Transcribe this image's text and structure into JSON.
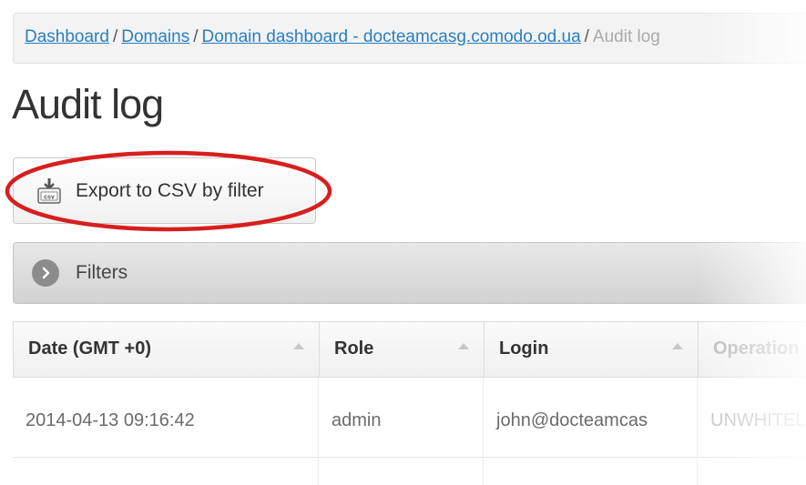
{
  "breadcrumb": {
    "items": [
      {
        "label": "Dashboard"
      },
      {
        "label": "Domains"
      },
      {
        "label": "Domain dashboard - docteamcasg.comodo.od.ua"
      }
    ],
    "separator": "/",
    "current": "Audit log"
  },
  "page": {
    "title": "Audit log"
  },
  "toolbar": {
    "export_label": "Export to CSV by filter",
    "export_icon": "csv-download-icon",
    "icon_text": "csv"
  },
  "filters": {
    "label": "Filters",
    "icon": "chevron-right-icon"
  },
  "table": {
    "columns": [
      {
        "label": "Date (GMT +0)"
      },
      {
        "label": "Role"
      },
      {
        "label": "Login"
      },
      {
        "label": "Operation"
      }
    ],
    "rows": [
      {
        "date": "2014-04-13 09:16:42",
        "role": "admin",
        "login": "john@docteamcas",
        "operation": "UNWHITEL"
      }
    ]
  },
  "colors": {
    "link": "#2a7fc0",
    "highlight": "#d81e1e"
  }
}
